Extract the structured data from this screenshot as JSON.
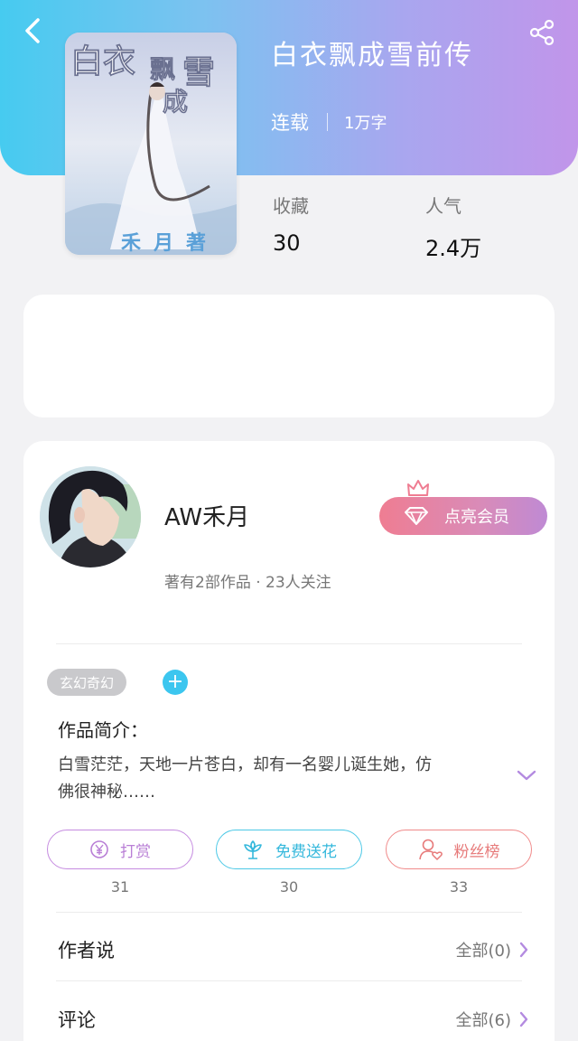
{
  "header": {
    "back_icon": "chevron-left-icon",
    "share_icon": "share-icon"
  },
  "book": {
    "title": "白衣飘成雪前传",
    "status": "连载",
    "word_count": "1万字",
    "cover_title": "白衣飘成雪",
    "cover_author": "禾月著",
    "stats": {
      "favorites_label": "收藏",
      "favorites_value": "30",
      "popularity_label": "人气",
      "popularity_value": "2.4万"
    }
  },
  "author": {
    "name": "AW禾月",
    "stats": "著有2部作品 · 23人关注",
    "vip_button": "点亮会员"
  },
  "work": {
    "tag": "玄幻奇幻",
    "add_tag": "+",
    "intro_title": "作品简介：",
    "intro_text": "白雪茫茫，天地一片苍白，却有一名婴儿诞生她，仿佛很神秘……"
  },
  "actions": [
    {
      "label": "打赏",
      "count": "31",
      "icon": "yen-coin-icon",
      "color": "#b97fd6"
    },
    {
      "label": "免费送花",
      "count": "30",
      "icon": "flower-icon",
      "color": "#35b8dc"
    },
    {
      "label": "粉丝榜",
      "count": "33",
      "icon": "user-heart-icon",
      "color": "#e77a7a"
    }
  ],
  "sections": {
    "author_say": {
      "title": "作者说",
      "more": "全部(0)"
    },
    "comments": {
      "title": "评论",
      "more": "全部(6)"
    }
  },
  "colors": {
    "header_gradient_start": "#46cbf0",
    "header_gradient_end": "#c195ea",
    "accent_purple": "#b97fd6",
    "accent_blue": "#35b8dc",
    "accent_red": "#e77a7a"
  }
}
